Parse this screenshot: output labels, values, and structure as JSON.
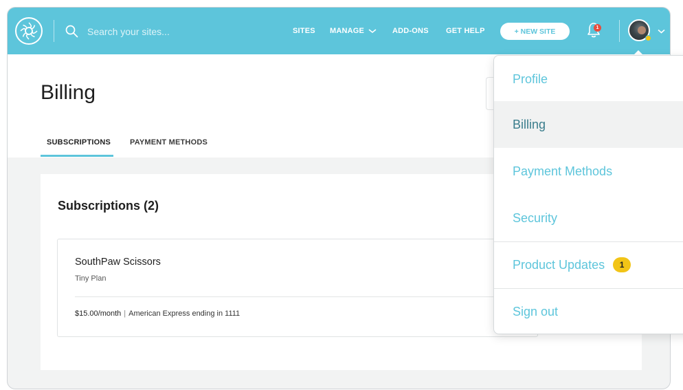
{
  "topbar": {
    "search_placeholder": "Search your sites...",
    "nav": {
      "sites": "SITES",
      "manage": "MANAGE",
      "addons": "ADD-ONS",
      "get_help": "GET HELP"
    },
    "new_site_label": "+ NEW SITE",
    "notification_count": "1",
    "brand_color": "#5dc5db"
  },
  "page": {
    "title": "Billing",
    "tabs": [
      {
        "label": "SUBSCRIPTIONS",
        "active": true
      },
      {
        "label": "PAYMENT METHODS",
        "active": false
      }
    ]
  },
  "subscriptions": {
    "heading": "Subscriptions (2)",
    "items": [
      {
        "name": "SouthPaw Scissors",
        "plan": "Tiny Plan",
        "price": "$15.00/month",
        "separator": "|",
        "payment": "American Express ending in 1111"
      }
    ]
  },
  "user_menu": {
    "items": [
      {
        "label": "Profile"
      },
      {
        "label": "Billing",
        "active": true
      },
      {
        "label": "Payment Methods"
      },
      {
        "label": "Security"
      },
      {
        "label": "Product Updates",
        "badge": "1"
      },
      {
        "label": "Sign out"
      }
    ],
    "badge_color": "#f2c417"
  }
}
